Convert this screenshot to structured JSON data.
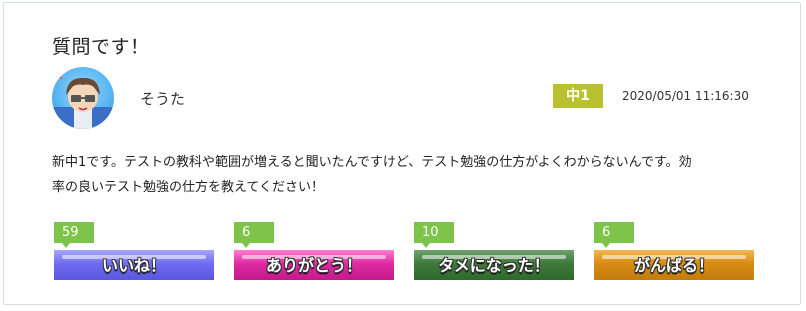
{
  "post": {
    "title": "質問です！",
    "username": "そうた",
    "grade": "中1",
    "timestamp": "2020/05/01 11:16:30",
    "body_line1": "新中1です。テストの教科や範囲が増えると聞いたんですけど、テスト勉強の仕方がよくわからないんです。効",
    "body_line2": "率の良いテスト勉強の仕方を教えてください！"
  },
  "reactions": [
    {
      "count": "59",
      "label": "いいね！",
      "color": "#6f6cf1"
    },
    {
      "count": "6",
      "label": "ありがとう！",
      "color": "#e02aa2"
    },
    {
      "count": "10",
      "label": "タメになった！",
      "color": "#3f7a3c"
    },
    {
      "count": "6",
      "label": "がんばる！",
      "color": "#d98c12"
    }
  ],
  "colors": {
    "grade_badge": "#b8c12f",
    "count_badge": "#7fc44a"
  }
}
